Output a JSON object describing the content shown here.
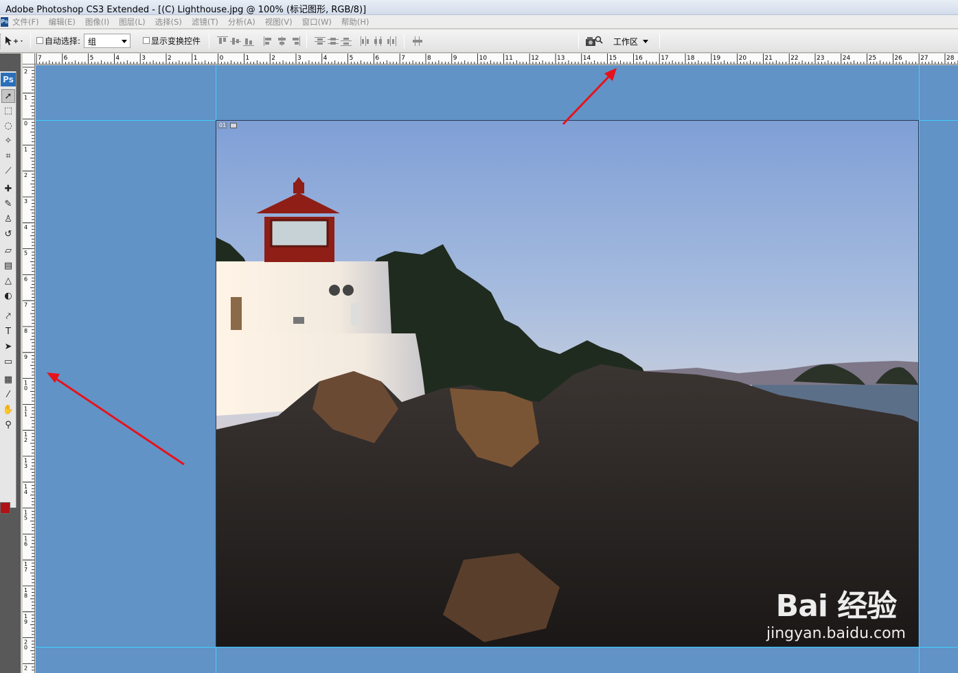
{
  "window": {
    "title": "Adobe Photoshop CS3 Extended - [(C) Lighthouse.jpg @ 100% (标记图形, RGB/8)]"
  },
  "menubar": {
    "app_badge": "Ps",
    "items": [
      "文件(F)",
      "编辑(E)",
      "图像(I)",
      "图层(L)",
      "选择(S)",
      "滤镜(T)",
      "分析(A)",
      "视图(V)",
      "窗口(W)",
      "帮助(H)"
    ]
  },
  "options": {
    "auto_select_label": "自动选择:",
    "auto_select_value": "组",
    "show_transform_label": "显示变换控件",
    "workspace_label": "工作区"
  },
  "toolbox": {
    "logo": "Ps",
    "tools": [
      "move-tool",
      "marquee-tool",
      "lasso-tool",
      "magic-wand-tool",
      "crop-tool",
      "slice-tool",
      "healing-brush-tool",
      "brush-tool",
      "clone-stamp-tool",
      "history-brush-tool",
      "eraser-tool",
      "gradient-tool",
      "blur-tool",
      "dodge-tool",
      "pen-tool",
      "type-tool",
      "path-selection-tool",
      "shape-tool",
      "notes-tool",
      "eyedropper-tool",
      "hand-tool",
      "zoom-tool"
    ],
    "foreground_color": "#b01316",
    "background_color": "#ffffff"
  },
  "rulers": {
    "horizontal": [
      "7",
      "6",
      "5",
      "4",
      "3",
      "2",
      "1",
      "0",
      "1",
      "2",
      "3",
      "4",
      "5",
      "6",
      "7",
      "8",
      "9",
      "10",
      "11",
      "12",
      "13",
      "14",
      "15",
      "16",
      "17",
      "18",
      "19",
      "20",
      "21",
      "22",
      "23",
      "24",
      "25",
      "26",
      "27",
      "28"
    ],
    "vertical": [
      "2",
      "1",
      "0",
      "1",
      "2",
      "3",
      "4",
      "5",
      "6",
      "7",
      "8",
      "9",
      "10",
      "11",
      "12",
      "13",
      "14",
      "15",
      "16",
      "17",
      "18",
      "19",
      "20",
      "2"
    ]
  },
  "document": {
    "slice_label": "01",
    "watermark_brand": "Bai 经验",
    "watermark_url": "jingyan.baidu.com"
  },
  "colors": {
    "workspace": "#6193c6",
    "guide": "#3fd0ff",
    "arrow": "#e8121a"
  }
}
